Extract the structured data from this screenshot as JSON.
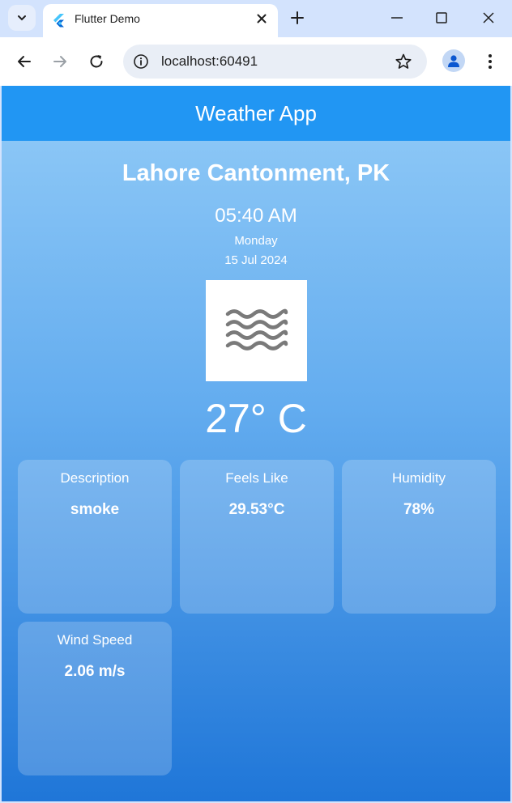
{
  "browser": {
    "tab_title": "Flutter Demo",
    "url": "localhost:60491"
  },
  "app": {
    "title": "Weather App",
    "city": "Lahore Cantonment, PK",
    "time": "05:40 AM",
    "day": "Monday",
    "date": "15 Jul 2024",
    "weather_icon": "haze-waves-icon",
    "temperature": "27° C",
    "cards": [
      {
        "label": "Description",
        "value": "smoke"
      },
      {
        "label": "Feels Like",
        "value": "29.53°C"
      },
      {
        "label": "Humidity",
        "value": "78%"
      },
      {
        "label": "Wind Speed",
        "value": "2.06 m/s"
      }
    ]
  },
  "colors": {
    "appbar": "#2196f3",
    "gradient_top": "#92cbf7",
    "gradient_bottom": "#1f76d8"
  }
}
